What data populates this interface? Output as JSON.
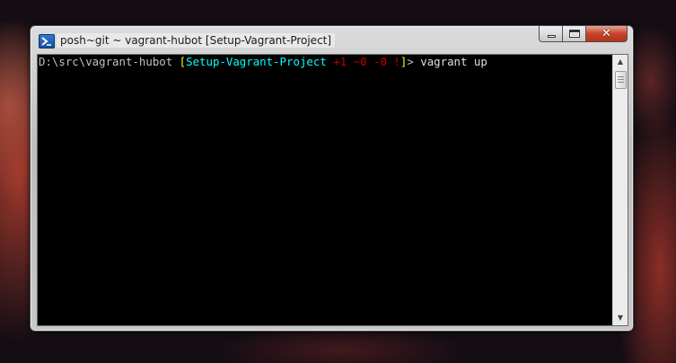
{
  "window": {
    "title": "posh~git ~ vagrant-hubot [Setup-Vagrant-Project]",
    "icon": "powershell-icon",
    "buttons": {
      "minimize": "minimize-icon",
      "maximize": "maximize-icon",
      "close": "✕"
    }
  },
  "console": {
    "prompt": {
      "path": "D:\\src\\vagrant-hubot ",
      "open_bracket": "[",
      "branch": "Setup-Vagrant-Project",
      "status": " +1 ~0 -0 !",
      "close_bracket": "]",
      "suffix": "> ",
      "command": "vagrant up"
    },
    "colors": {
      "background": "#000000",
      "text": "#c0c0c0",
      "bracket": "#ffff00",
      "branch": "#00ffff",
      "status": "#c00000"
    }
  }
}
